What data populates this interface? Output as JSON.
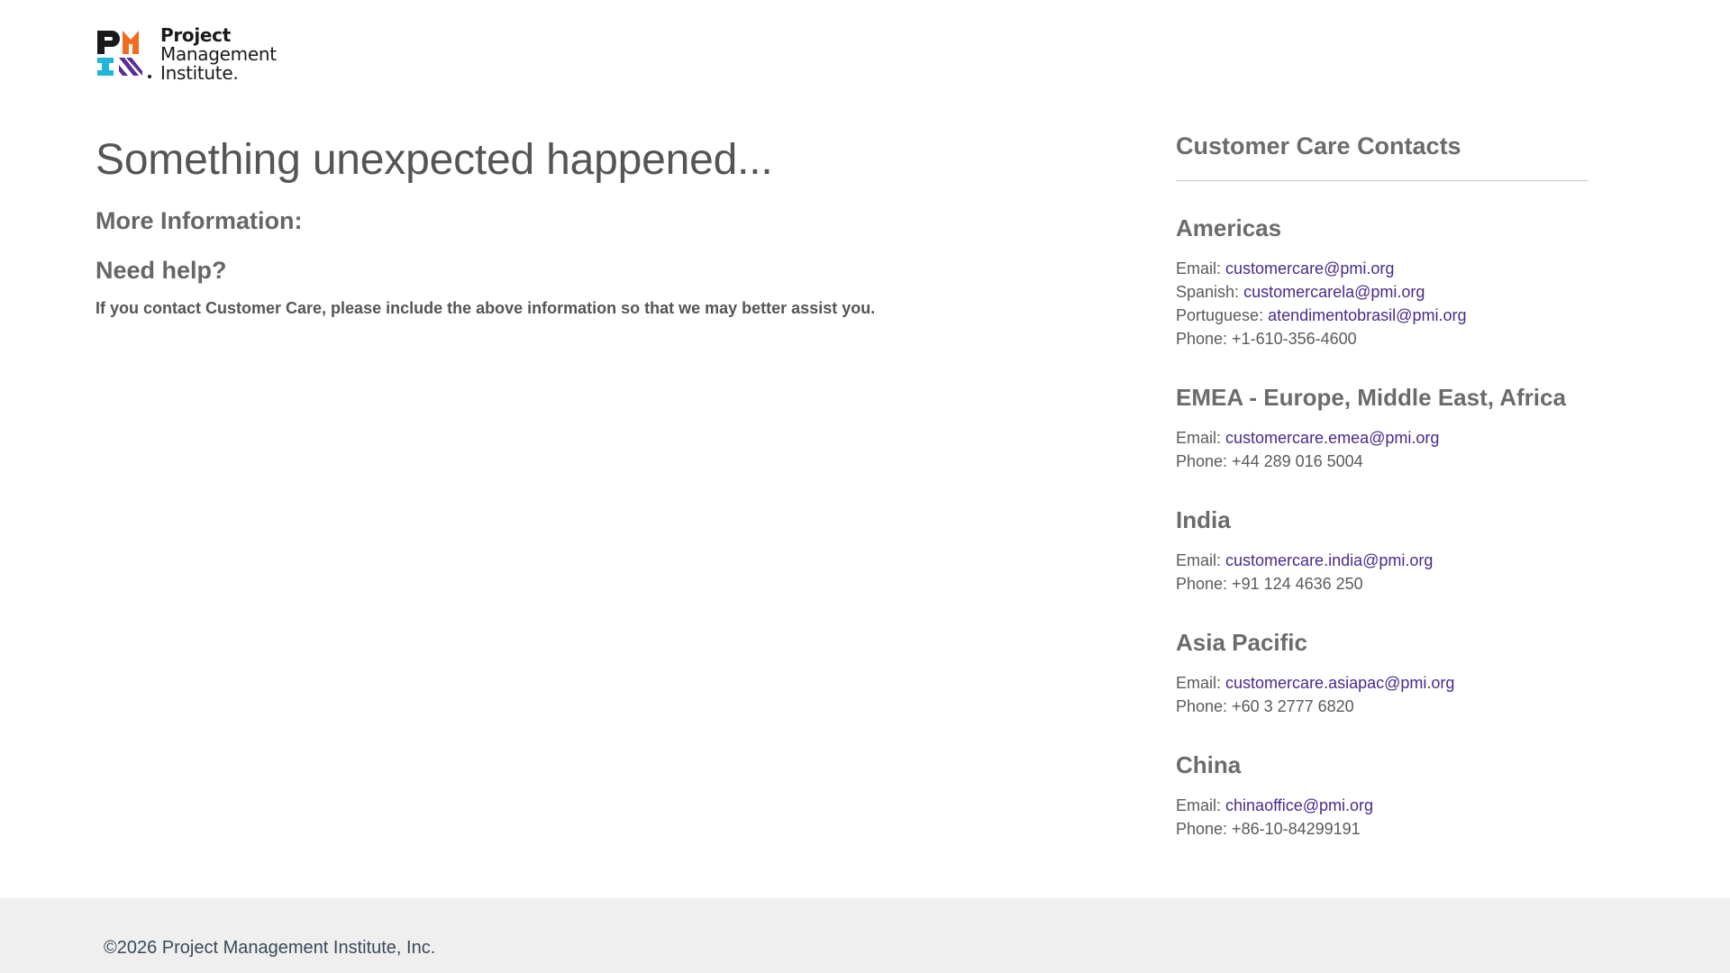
{
  "logo": {
    "line1": "Project",
    "line2": "Management",
    "line3": "Institute.",
    "icon": "pmi-logo-icon"
  },
  "main": {
    "heading": "Something unexpected happened...",
    "more_info": "More Information:",
    "need_help": "Need help?",
    "note": "If you contact Customer Care, please include the above information so that we may better assist you."
  },
  "sidebar": {
    "title": "Customer Care Contacts",
    "regions": [
      {
        "name": "Americas",
        "email_label": "Email:",
        "email": "customercare@pmi.org",
        "spanish_label": "Spanish:",
        "spanish_email": "customercarela@pmi.org",
        "portuguese_label": "Portuguese:",
        "portuguese_email": "atendimentobrasil@pmi.org",
        "phone": "Phone: +1-610-356-4600"
      },
      {
        "name": "EMEA - Europe, Middle East, Africa",
        "email_label": "Email:",
        "email": "customercare.emea@pmi.org",
        "phone": "Phone: +44 289 016 5004"
      },
      {
        "name": "India",
        "email_label": "Email:",
        "email": "customercare.india@pmi.org",
        "phone": "Phone: +91 124 4636 250"
      },
      {
        "name": "Asia Pacific",
        "email_label": "Email:",
        "email": "customercare.asiapac@pmi.org",
        "phone": "Phone: +60 3 2777 6820"
      },
      {
        "name": "China",
        "email_label": "Email:",
        "email": "chinaoffice@pmi.org",
        "phone": "Phone: +86-10-84299191"
      }
    ]
  },
  "footer": {
    "copyright": "©2026 Project Management Institute, Inc."
  },
  "colors": {
    "link": "#4a2a8a",
    "footer_bg": "#efefef",
    "logo_orange": "#f26b21",
    "logo_cyan": "#1fb6d8",
    "logo_purple": "#5a2d91"
  }
}
